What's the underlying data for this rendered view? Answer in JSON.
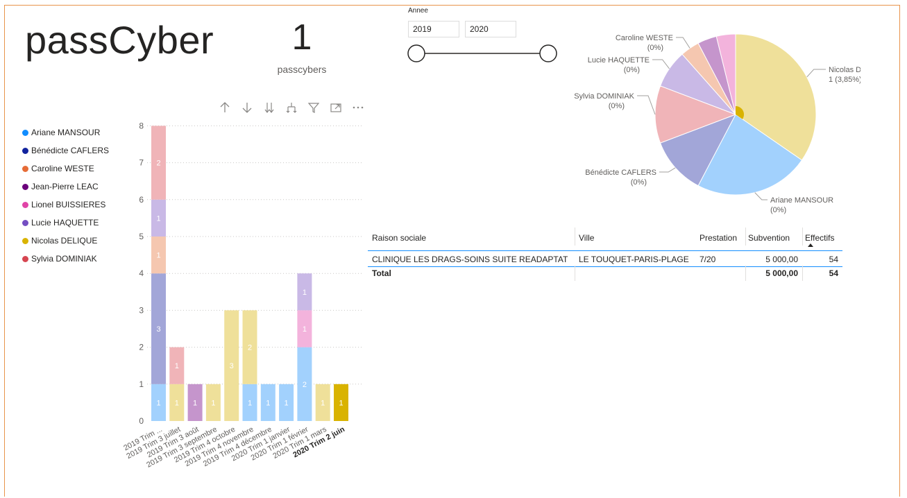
{
  "title": "passCyber",
  "kpi": {
    "value": "1",
    "label": "passcybers"
  },
  "slicer": {
    "title": "Annee",
    "from": "2019",
    "to": "2020"
  },
  "legend": [
    {
      "name": "Ariane MANSOUR",
      "color": "#118dff"
    },
    {
      "name": "Bénédicte CAFLERS",
      "color": "#12239e"
    },
    {
      "name": "Caroline WESTE",
      "color": "#e66c37"
    },
    {
      "name": "Jean-Pierre LEAC",
      "color": "#6b007b"
    },
    {
      "name": "Lionel BUISSIERES",
      "color": "#e044a7"
    },
    {
      "name": "Lucie HAQUETTE",
      "color": "#744ec2"
    },
    {
      "name": "Nicolas DELIQUE",
      "color": "#d9b300"
    },
    {
      "name": "Sylvia DOMINIAK",
      "color": "#d64550"
    }
  ],
  "toolbar": [
    "arrow-up-icon",
    "arrow-down-icon",
    "double-arrow-down-icon",
    "expand-hierarchy-icon",
    "filter-icon",
    "focus-mode-icon",
    "more-options-icon"
  ],
  "chart_data": [
    {
      "type": "bar",
      "stacked": true,
      "categories": [
        "2019 Trim ...",
        "2019 Trim 3 juillet",
        "2019 Trim 3 août",
        "2019 Trim 3 septembre",
        "2019 Trim 4 octobre",
        "2019 Trim 4 novembre",
        "2019 Trim 4 décembre",
        "2020 Trim 1 janvier",
        "2020 Trim 1 février",
        "2020 Trim 1 mars",
        "2020 Trim 2 juin"
      ],
      "highlighted_category": "2020 Trim 2 juin",
      "ylim": [
        0,
        8
      ],
      "yticks": [
        "0",
        "1",
        "2",
        "3",
        "4",
        "5",
        "6",
        "7",
        "8"
      ],
      "grid": true,
      "stacks": [
        [
          {
            "series": "Ariane MANSOUR",
            "value": 1,
            "color": "#a2d1fd"
          },
          {
            "series": "Bénédicte CAFLERS",
            "value": 3,
            "color": "#a2a6d8"
          },
          {
            "series": "Caroline WESTE",
            "value": 1,
            "color": "#f5c7b0"
          },
          {
            "series": "Lucie HAQUETTE",
            "value": 1,
            "color": "#c9b9e6"
          },
          {
            "series": "Sylvia DOMINIAK",
            "value": 2,
            "color": "#f0b4b8"
          }
        ],
        [
          {
            "series": "Nicolas DELIQUE",
            "value": 1,
            "color": "#efe09a"
          },
          {
            "series": "Sylvia DOMINIAK",
            "value": 1,
            "color": "#f0b4b8"
          }
        ],
        [
          {
            "series": "Jean-Pierre LEAC",
            "value": 1,
            "color": "#c595cc"
          }
        ],
        [
          {
            "series": "Nicolas DELIQUE",
            "value": 1,
            "color": "#efe09a"
          }
        ],
        [
          {
            "series": "Nicolas DELIQUE",
            "value": 3,
            "color": "#efe09a"
          }
        ],
        [
          {
            "series": "Ariane MANSOUR",
            "value": 1,
            "color": "#a2d1fd"
          },
          {
            "series": "Nicolas DELIQUE",
            "value": 2,
            "color": "#efe09a"
          }
        ],
        [
          {
            "series": "Ariane MANSOUR",
            "value": 1,
            "color": "#a2d1fd"
          }
        ],
        [
          {
            "series": "Ariane MANSOUR",
            "value": 1,
            "color": "#a2d1fd"
          }
        ],
        [
          {
            "series": "Ariane MANSOUR",
            "value": 2,
            "color": "#a2d1fd"
          },
          {
            "series": "Lionel BUISSIERES",
            "value": 1,
            "color": "#f3b3dc"
          },
          {
            "series": "Lucie HAQUETTE",
            "value": 1,
            "color": "#c9b9e6"
          }
        ],
        [
          {
            "series": "Nicolas DELIQUE",
            "value": 1,
            "color": "#efe09a"
          }
        ],
        [
          {
            "series": "Nicolas DELIQUE",
            "value": 1,
            "color": "#d9b300"
          }
        ]
      ]
    },
    {
      "type": "pie",
      "slices": [
        {
          "name": "Nicolas DELIQUE",
          "value": 9,
          "color": "#efe09a",
          "label": "Nicolas DELIQUE",
          "sublabel": "1 (3,85%)"
        },
        {
          "name": "Ariane MANSOUR",
          "value": 6,
          "color": "#a2d1fd",
          "label": "Ariane MANSOUR",
          "sublabel": "(0%)"
        },
        {
          "name": "Bénédicte CAFLERS",
          "value": 3,
          "color": "#a2a6d8",
          "label": "Bénédicte CAFLERS",
          "sublabel": "(0%)"
        },
        {
          "name": "Sylvia DOMINIAK",
          "value": 3,
          "color": "#f0b4b8",
          "label": "Sylvia DOMINIAK",
          "sublabel": "(0%)"
        },
        {
          "name": "Lucie HAQUETTE",
          "value": 2,
          "color": "#c9b9e6",
          "label": "Lucie HAQUETTE",
          "sublabel": "(0%)"
        },
        {
          "name": "Caroline WESTE",
          "value": 1,
          "color": "#f5c7b0",
          "label": "Caroline WESTE",
          "sublabel": "(0%)"
        },
        {
          "name": "Jean-Pierre LEAC",
          "value": 1,
          "color": "#c595cc",
          "label": "",
          "sublabel": ""
        },
        {
          "name": "Lionel BUISSIERES",
          "value": 1,
          "color": "#f3b3dc",
          "label": "",
          "sublabel": ""
        }
      ],
      "highlighted": {
        "name": "Nicolas DELIQUE",
        "value": 1,
        "color": "#d9b300"
      }
    }
  ],
  "table": {
    "headers": [
      "Raison sociale",
      "Ville",
      "Prestation",
      "Subvention",
      "Effectifs"
    ],
    "sort_column": "Effectifs",
    "rows": [
      [
        "CLINIQUE LES DRAGS-SOINS SUITE READAPTAT",
        "LE TOUQUET-PARIS-PLAGE",
        "7/20",
        "5 000,00",
        "54"
      ]
    ],
    "total": [
      "Total",
      "",
      "",
      "5 000,00",
      "54"
    ]
  }
}
